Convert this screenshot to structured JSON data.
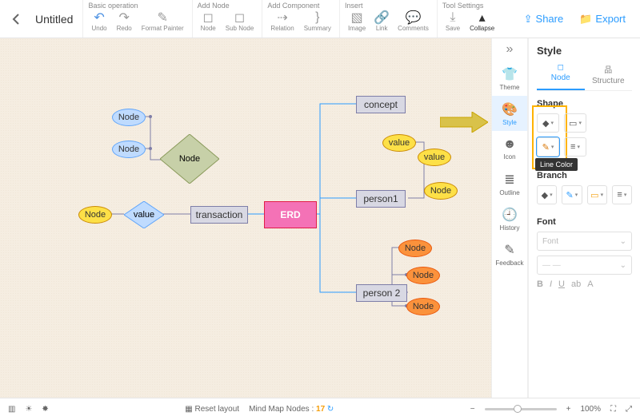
{
  "doc_title": "Untitled",
  "toolbar": {
    "groups": [
      {
        "label": "Basic operation",
        "items": [
          {
            "id": "undo",
            "label": "Undo",
            "icon": "↶",
            "blue": true
          },
          {
            "id": "redo",
            "label": "Redo",
            "icon": "↷"
          },
          {
            "id": "format-painter",
            "label": "Format Painter",
            "icon": "✎"
          }
        ]
      },
      {
        "label": "Add Node",
        "items": [
          {
            "id": "node",
            "label": "Node",
            "icon": "◻"
          },
          {
            "id": "sub-node",
            "label": "Sub Node",
            "icon": "◻"
          }
        ]
      },
      {
        "label": "Add Component",
        "items": [
          {
            "id": "relation",
            "label": "Relation",
            "icon": "⇢"
          },
          {
            "id": "summary",
            "label": "Summary",
            "icon": "}"
          }
        ]
      },
      {
        "label": "Insert",
        "items": [
          {
            "id": "image",
            "label": "Image",
            "icon": "▧"
          },
          {
            "id": "link",
            "label": "Link",
            "icon": "🔗"
          },
          {
            "id": "comments",
            "label": "Comments",
            "icon": "💬"
          }
        ]
      },
      {
        "label": "Tool Settings",
        "items": [
          {
            "id": "save",
            "label": "Save",
            "icon": "⤓"
          },
          {
            "id": "collapse",
            "label": "Collapse",
            "icon": "▴"
          }
        ]
      }
    ],
    "share": "Share",
    "export": "Export"
  },
  "right_tabs": [
    {
      "id": "theme",
      "label": "Theme",
      "icon": "👕"
    },
    {
      "id": "style",
      "label": "Style",
      "icon": "🎨",
      "active": true
    },
    {
      "id": "icon",
      "label": "Icon",
      "icon": "☻"
    },
    {
      "id": "outline",
      "label": "Outline",
      "icon": "≣"
    },
    {
      "id": "history",
      "label": "History",
      "icon": "🕘"
    },
    {
      "id": "feedback",
      "label": "Feedback",
      "icon": "✎"
    }
  ],
  "panel": {
    "title": "Style",
    "tabs": [
      {
        "id": "node",
        "label": "Node",
        "active": true
      },
      {
        "id": "structure",
        "label": "Structure"
      }
    ],
    "sections": {
      "shape": "Shape",
      "branch": "Branch",
      "font": "Font"
    },
    "font_placeholder": "Font",
    "tooltip": "Line Color"
  },
  "canvas": {
    "root": {
      "label": "ERD"
    },
    "nodes": {
      "concept": "concept",
      "person1": "person1",
      "person2": "person 2",
      "transaction": "transaction",
      "value1": "value",
      "value2": "value",
      "value3": "value",
      "node_a": "Node",
      "node_b": "Node",
      "node_c": "Node",
      "node_d": "Node",
      "diamond_node": "Node",
      "o1": "Node",
      "o2": "Node",
      "o3": "Node"
    }
  },
  "status": {
    "reset": "Reset layout",
    "counter_label": "Mind Map Nodes :",
    "counter_value": "17",
    "zoom": "100%"
  },
  "colors": {
    "root_fill": "#f472b6",
    "root_border": "#e11d48",
    "gray_fill": "#d8d8e3",
    "gray_border": "#7e7ea8",
    "yellow_fill": "#fde047",
    "yellow_border": "#ca8a04",
    "orange_fill": "#fb923c",
    "orange_border": "#ea580c",
    "olive_fill": "#c7d0a8",
    "olive_border": "#8a9a5b",
    "blue_fill": "#bfdbfe",
    "blue_border": "#60a5fa"
  }
}
